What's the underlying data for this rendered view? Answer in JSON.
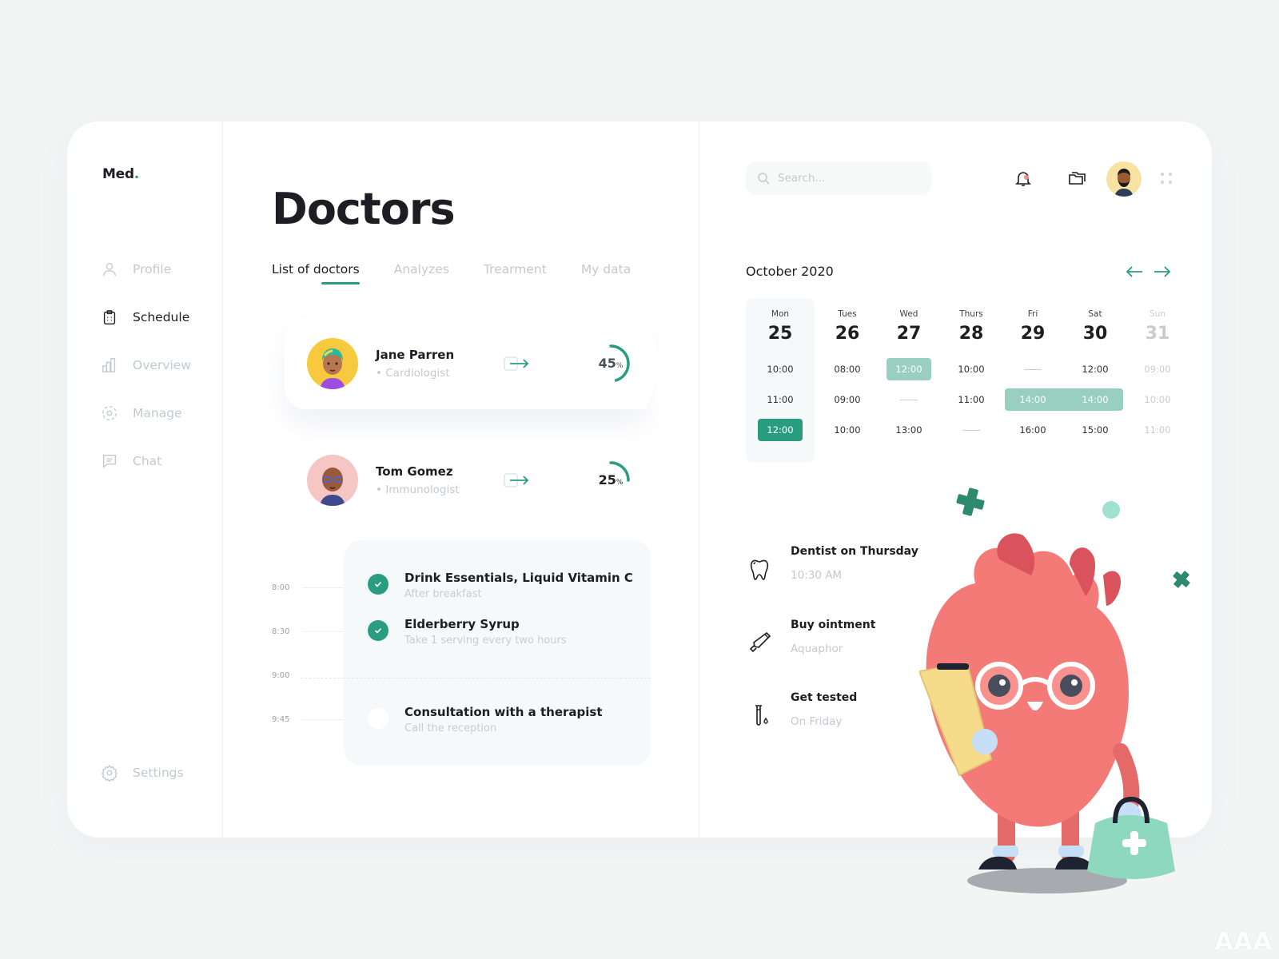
{
  "brand": {
    "name": "Med",
    "dot": ".",
    "accent": "#2a9d80"
  },
  "sidebar": {
    "items": [
      {
        "label": "Profile",
        "icon": "user-icon",
        "active": false
      },
      {
        "label": "Schedule",
        "icon": "clipboard-icon",
        "active": true
      },
      {
        "label": "Overview",
        "icon": "bar-chart-icon",
        "active": false
      },
      {
        "label": "Manage",
        "icon": "target-icon",
        "active": false
      },
      {
        "label": "Chat",
        "icon": "chat-icon",
        "active": false
      }
    ],
    "settings": {
      "label": "Settings",
      "icon": "gear-icon"
    }
  },
  "main": {
    "title": "Doctors",
    "tabs": [
      {
        "label": "List of doctors",
        "active": true
      },
      {
        "label": "Analyzes",
        "active": false
      },
      {
        "label": "Trearment",
        "active": false
      },
      {
        "label": "My data",
        "active": false
      }
    ],
    "doctors": [
      {
        "name": "Jane Parren",
        "specialty": "• Cardiologist",
        "progress": 45,
        "progress_label": "45",
        "unit": "%"
      },
      {
        "name": "Tom Gomez",
        "specialty": "•  Immunologist",
        "progress": 25,
        "progress_label": "25",
        "unit": "%"
      }
    ],
    "timeline": {
      "times": [
        "8:00",
        "8:30",
        "9:00",
        "9:45"
      ],
      "tasks": [
        {
          "title": "Drink Essentials, Liquid Vitamin C",
          "subtitle": "After breakfast",
          "done": true
        },
        {
          "title": "Elderberry Syrup",
          "subtitle": "Take 1 serving every two hours",
          "done": true
        },
        {
          "title": "Consultation with a therapist",
          "subtitle": "Call the reception",
          "done": false
        }
      ]
    }
  },
  "header": {
    "search_placeholder": "Search...",
    "icons": [
      "search-icon",
      "bell-icon",
      "folders-icon",
      "avatar",
      "grid-dots-icon"
    ]
  },
  "calendar": {
    "month": "October 2020",
    "days": [
      {
        "name": "Mon",
        "date": "25",
        "slots": [
          "10:00",
          "11:00",
          "12:00"
        ],
        "selected": [
          2
        ],
        "highlight": []
      },
      {
        "name": "Tues",
        "date": "26",
        "slots": [
          "08:00",
          "09:00",
          "10:00"
        ],
        "selected": [],
        "highlight": []
      },
      {
        "name": "Wed",
        "date": "27",
        "slots": [
          "12:00",
          "—",
          "13:00"
        ],
        "selected": [],
        "highlight": [
          0
        ]
      },
      {
        "name": "Thurs",
        "date": "28",
        "slots": [
          "10:00",
          "11:00",
          "—"
        ],
        "selected": [],
        "highlight": []
      },
      {
        "name": "Fri",
        "date": "29",
        "slots": [
          "—",
          "14:00",
          "16:00"
        ],
        "selected": [],
        "highlight": [
          1
        ]
      },
      {
        "name": "Sat",
        "date": "30",
        "slots": [
          "12:00",
          "14:00",
          "15:00"
        ],
        "selected": [],
        "highlight": [
          1
        ]
      },
      {
        "name": "Sun",
        "date": "31",
        "slots": [
          "09:00",
          "10:00",
          "11:00"
        ],
        "selected": [],
        "highlight": [],
        "muted": true
      }
    ]
  },
  "todos": [
    {
      "title": "Dentist on Thursday",
      "subtitle": "10:30 AM",
      "icon": "tooth-icon"
    },
    {
      "title": "Buy ointment",
      "subtitle": "Aquaphor",
      "icon": "ointment-tube-icon"
    },
    {
      "title": "Get tested",
      "subtitle": "On Friday",
      "icon": "test-tube-icon"
    }
  ],
  "watermark": "AAA"
}
